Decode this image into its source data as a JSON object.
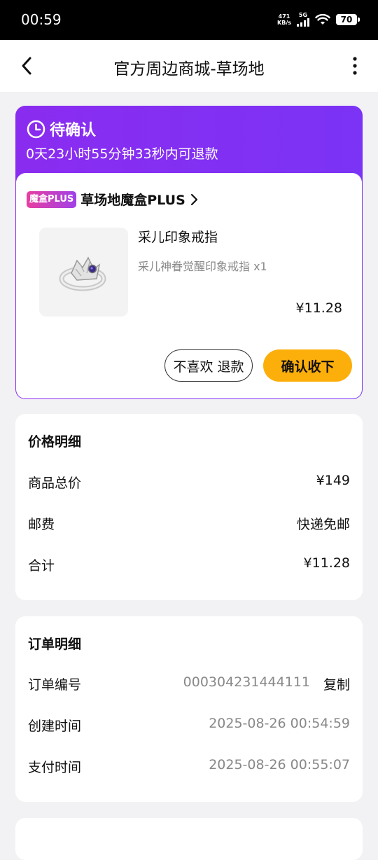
{
  "status_bar": {
    "time": "00:59",
    "net_speed_value": "471",
    "net_speed_unit": "KB/s",
    "network_type": "5G",
    "battery": "70"
  },
  "navbar": {
    "title": "官方周边商城-草场地",
    "back_icon": "chevron-left-icon",
    "more_icon": "more-vertical-icon"
  },
  "order": {
    "status": "待确认",
    "countdown_text": "0天23小时55分钟33秒内可退款",
    "brand_badge": "魔盒PLUS",
    "brand_name": "草场地魔盒PLUS",
    "product": {
      "title": "采儿印象戒指",
      "spec": "采儿神眷觉醒印象戒指 x1",
      "price": "¥11.28"
    },
    "refund_button": "不喜欢 退款",
    "confirm_button": "确认收下",
    "colors": {
      "header_start": "#8a2cf0",
      "header_end": "#7b33f5",
      "confirm": "#fcae0b"
    }
  },
  "price_details": {
    "title": "价格明细",
    "rows": [
      {
        "label": "商品总价",
        "value": "¥149"
      },
      {
        "label": "邮费",
        "value": "快递免邮"
      },
      {
        "label": "合计",
        "value": "¥11.28"
      }
    ]
  },
  "order_details": {
    "title": "订单明细",
    "order_no_label": "订单编号",
    "order_no": "000304231444111",
    "copy_label": "复制",
    "created_label": "创建时间",
    "created_time": "2025-08-26 00:54:59",
    "paid_label": "支付时间",
    "paid_time": "2025-08-26 00:55:07"
  }
}
